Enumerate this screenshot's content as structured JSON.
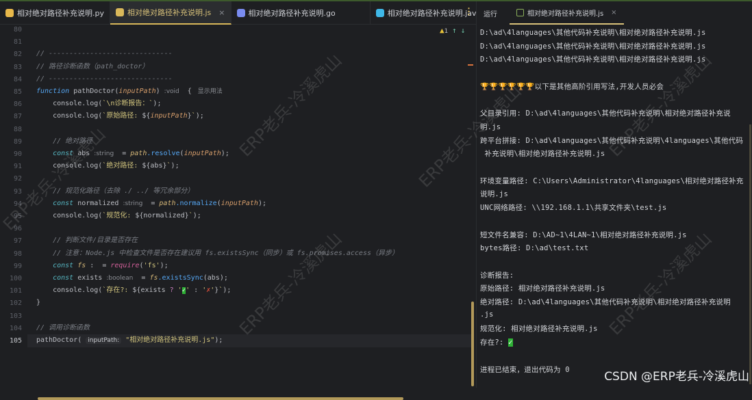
{
  "tabs": [
    {
      "label": "相对绝对路径补充说明.py",
      "icon": "python-icon",
      "color": "#e8b84a",
      "active": false
    },
    {
      "label": "相对绝对路径补充说明.js",
      "icon": "javascript-icon",
      "color": "#d9b85a",
      "active": true
    },
    {
      "label": "相对绝对路径补充说明.go",
      "icon": "go-icon",
      "color": "#7a8cf0",
      "active": false
    },
    {
      "label": "相对绝对路径补充说明.java",
      "icon": "java-icon",
      "color": "#3fb8e8",
      "active": false
    }
  ],
  "indicators": {
    "warning_count": "1"
  },
  "editor": {
    "current_line": "105",
    "lines": [
      {
        "n": "80",
        "t": []
      },
      {
        "n": "81",
        "t": []
      },
      {
        "n": "82",
        "t": [
          [
            "com",
            "// ------------------------------"
          ]
        ]
      },
      {
        "n": "83",
        "t": [
          [
            "com",
            "// 路径诊断函数（path_doctor）"
          ]
        ]
      },
      {
        "n": "84",
        "t": [
          [
            "com",
            "// ------------------------------"
          ]
        ]
      },
      {
        "n": "85",
        "t": [
          [
            "fn",
            "function"
          ],
          [
            "id",
            " pathDoctor("
          ],
          [
            "param",
            "inputPath"
          ],
          [
            "id",
            ") "
          ],
          [
            "hint",
            ":void"
          ],
          [
            "id",
            "  { "
          ],
          [
            "hint",
            " 显示用法"
          ]
        ]
      },
      {
        "n": "86",
        "t": [
          [
            "id",
            "    console.log("
          ],
          [
            "str",
            "`\\n诊断报告：`"
          ],
          [
            "id",
            ");"
          ]
        ]
      },
      {
        "n": "87",
        "t": [
          [
            "id",
            "    console.log("
          ],
          [
            "str",
            "`原始路径: "
          ],
          [
            "id",
            "${"
          ],
          [
            "param",
            "inputPath"
          ],
          [
            "id",
            "}"
          ],
          [
            "str",
            "`"
          ],
          [
            "id",
            ");"
          ]
        ]
      },
      {
        "n": "88",
        "t": []
      },
      {
        "n": "89",
        "t": [
          [
            "com",
            "    // 绝对路径"
          ]
        ]
      },
      {
        "n": "90",
        "t": [
          [
            "kw",
            "    const"
          ],
          [
            "id",
            " abs "
          ],
          [
            "hint",
            ":string"
          ],
          [
            "id",
            "  = "
          ],
          [
            "obj",
            "path"
          ],
          [
            "meth",
            ".resolve"
          ],
          [
            "id",
            "("
          ],
          [
            "param",
            "inputPath"
          ],
          [
            "id",
            ");"
          ]
        ]
      },
      {
        "n": "91",
        "t": [
          [
            "id",
            "    console.log("
          ],
          [
            "str",
            "`绝对路径: "
          ],
          [
            "id",
            "${abs}"
          ],
          [
            "str",
            "`"
          ],
          [
            "id",
            ");"
          ]
        ]
      },
      {
        "n": "92",
        "t": []
      },
      {
        "n": "93",
        "t": [
          [
            "com",
            "    // 规范化路径（去除 ./ ../ 等冗余部分）"
          ]
        ]
      },
      {
        "n": "94",
        "t": [
          [
            "kw",
            "    const"
          ],
          [
            "id",
            " normalized "
          ],
          [
            "hint",
            ":string"
          ],
          [
            "id",
            "  = "
          ],
          [
            "obj",
            "path"
          ],
          [
            "meth",
            ".normalize"
          ],
          [
            "id",
            "("
          ],
          [
            "param",
            "inputPath"
          ],
          [
            "id",
            ");"
          ]
        ]
      },
      {
        "n": "95",
        "t": [
          [
            "id",
            "    console.log("
          ],
          [
            "str",
            "`规范化: "
          ],
          [
            "id",
            "${normalized}"
          ],
          [
            "str",
            "`"
          ],
          [
            "id",
            ");"
          ]
        ]
      },
      {
        "n": "96",
        "t": []
      },
      {
        "n": "97",
        "t": [
          [
            "com",
            "    // 判断文件/目录是否存在"
          ]
        ]
      },
      {
        "n": "98",
        "t": [
          [
            "com",
            "    // 注意：Node.js 中检查文件是否存在建议用 fs.existsSync（同步）或 fs.promises.access（异步）"
          ]
        ]
      },
      {
        "n": "99",
        "t": [
          [
            "kw",
            "    const"
          ],
          [
            "obj",
            " fs"
          ],
          [
            "id",
            " :  = "
          ],
          [
            "req",
            "require"
          ],
          [
            "id",
            "("
          ],
          [
            "str",
            "'fs'"
          ],
          [
            "id",
            ");"
          ]
        ]
      },
      {
        "n": "100",
        "t": [
          [
            "kw",
            "    const"
          ],
          [
            "id",
            " exists "
          ],
          [
            "hint",
            ":boolean"
          ],
          [
            "id",
            "  = "
          ],
          [
            "obj",
            "fs"
          ],
          [
            "meth",
            ".existsSync"
          ],
          [
            "id",
            "(abs);"
          ]
        ]
      },
      {
        "n": "101",
        "t": [
          [
            "id",
            "    console.log("
          ],
          [
            "str",
            "`存在?: "
          ],
          [
            "id",
            "${exists "
          ],
          [
            "op",
            "?"
          ],
          [
            "str",
            " '"
          ],
          [
            "ok",
            "✓"
          ],
          [
            "str",
            "'"
          ],
          [
            "id",
            " : "
          ],
          [
            "str",
            "'"
          ],
          [
            "x",
            "✗"
          ],
          [
            "str",
            "'"
          ],
          [
            "id",
            "}"
          ],
          [
            "str",
            "`"
          ],
          [
            "id",
            ");"
          ]
        ]
      },
      {
        "n": "102",
        "t": [
          [
            "id",
            "}"
          ]
        ]
      },
      {
        "n": "103",
        "t": []
      },
      {
        "n": "104",
        "t": [
          [
            "com",
            "// 调用诊断函数"
          ]
        ]
      },
      {
        "n": "105",
        "t": [
          [
            "id",
            "pathDoctor( "
          ],
          [
            "hintbox",
            "inputPath:"
          ],
          [
            "str",
            " \"相对绝对路径补充说明.js\""
          ],
          [
            "id",
            ");"
          ]
        ]
      }
    ]
  },
  "run": {
    "label": "运行",
    "tab": "相对绝对路径补充说明.js",
    "output": [
      "D:\\ad\\4languages\\其他代码补充说明\\相对绝对路径补充说明.js",
      "D:\\ad\\4languages\\其他代码补充说明\\相对绝对路径补充说明.js",
      "D:\\ad\\4languages\\其他代码补充说明\\相对绝对路径补充说明.js",
      "",
      "🏆🏆🏆🏆🏆🏆以下是其他高阶引用写法,开发人员必会",
      "",
      "父目录引用: D:\\ad\\4languages\\其他代码补充说明\\相对绝对路径补充说",
      "明.js",
      "跨平台拼接: D:\\ad\\4languages\\其他代码补充说明\\4languages\\其他代码",
      " 补充说明\\相对绝对路径补充说明.js",
      "",
      "环境变量路径: C:\\Users\\Administrator\\4languages\\相对绝对路径补充",
      "说明.js",
      "UNC网络路径: \\\\192.168.1.1\\共享文件夹\\test.js",
      "",
      "短文件名兼容: D:\\AD~1\\4LAN~1\\相对绝对路径补充说明.js",
      "bytes路径: D:\\ad\\test.txt",
      "",
      "诊断报告:",
      "原始路径: 相对绝对路径补充说明.js",
      "绝对路径: D:\\ad\\4languages\\其他代码补充说明\\相对绝对路径补充说明",
      ".js",
      "规范化: 相对绝对路径补充说明.js",
      "存在?: ✓",
      "",
      "进程已结束，退出代码为 0"
    ]
  },
  "watermark": "ERP老兵-冷溪虎山",
  "credit": "CSDN @ERP老兵-冷溪虎山"
}
